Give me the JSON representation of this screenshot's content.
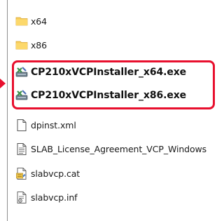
{
  "files": [
    {
      "label": "x64",
      "icon": "folder-icon"
    },
    {
      "label": "x86",
      "icon": "folder-icon"
    },
    {
      "label": "CP210xVCPInstaller_x64.exe",
      "icon": "installer-icon"
    },
    {
      "label": "CP210xVCPInstaller_x86.exe",
      "icon": "installer-icon"
    },
    {
      "label": "dpinst.xml",
      "icon": "blank-file-icon"
    },
    {
      "label": "SLAB_License_Agreement_VCP_Windows",
      "icon": "text-file-icon"
    },
    {
      "label": "slabvcp.cat",
      "icon": "catalog-file-icon"
    },
    {
      "label": "slabvcp.inf",
      "icon": "setup-info-file-icon"
    }
  ],
  "colors": {
    "highlight": "#e8102e",
    "folder": "#f8cd5a"
  }
}
